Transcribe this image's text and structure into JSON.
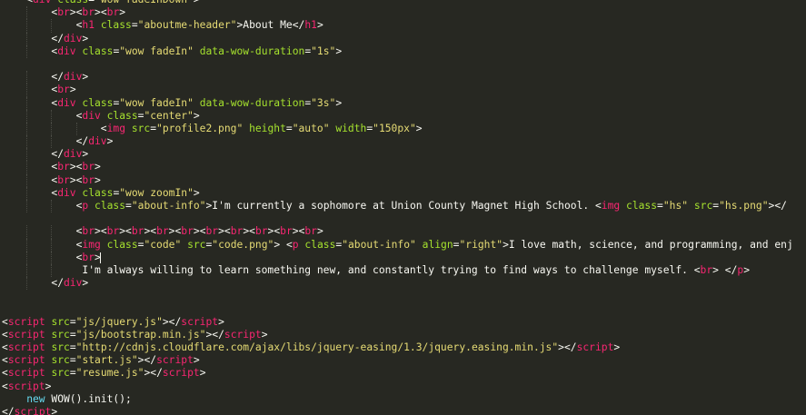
{
  "editor": {
    "theme": {
      "background": "#272822",
      "text": "#f8f8f2",
      "tag": "#f92672",
      "attribute": "#a6e22e",
      "string": "#e6db74",
      "keyword": "#66d9ef"
    },
    "lines": [
      {
        "indent": 1,
        "tokens": [
          [
            "p",
            "<"
          ],
          [
            "tag",
            "div"
          ],
          [
            "text",
            " "
          ],
          [
            "attr",
            "class"
          ],
          [
            "p",
            "="
          ],
          [
            "str",
            "\"wow fadeInDown\""
          ],
          [
            "p",
            ">"
          ]
        ]
      },
      {
        "indent": 2,
        "tokens": [
          [
            "p",
            "<"
          ],
          [
            "tag",
            "br"
          ],
          [
            "p",
            "><"
          ],
          [
            "tag",
            "br"
          ],
          [
            "p",
            "><"
          ],
          [
            "tag",
            "br"
          ],
          [
            "p",
            ">"
          ]
        ]
      },
      {
        "indent": 3,
        "tokens": [
          [
            "p",
            "<"
          ],
          [
            "tag",
            "h1"
          ],
          [
            "text",
            " "
          ],
          [
            "attr",
            "class"
          ],
          [
            "p",
            "="
          ],
          [
            "str",
            "\"aboutme-header\""
          ],
          [
            "p",
            ">"
          ],
          [
            "text",
            "About Me"
          ],
          [
            "p",
            "</"
          ],
          [
            "tag",
            "h1"
          ],
          [
            "p",
            ">"
          ]
        ]
      },
      {
        "indent": 2,
        "tokens": [
          [
            "p",
            "</"
          ],
          [
            "tag",
            "div"
          ],
          [
            "p",
            ">"
          ]
        ]
      },
      {
        "indent": 2,
        "tokens": [
          [
            "p",
            "<"
          ],
          [
            "tag",
            "div"
          ],
          [
            "text",
            " "
          ],
          [
            "attr",
            "class"
          ],
          [
            "p",
            "="
          ],
          [
            "str",
            "\"wow fadeIn\""
          ],
          [
            "text",
            " "
          ],
          [
            "attr",
            "data-wow-duration"
          ],
          [
            "p",
            "="
          ],
          [
            "str",
            "\"1s\""
          ],
          [
            "p",
            ">"
          ]
        ]
      },
      {
        "indent": 0,
        "tokens": []
      },
      {
        "indent": 2,
        "tokens": [
          [
            "p",
            "</"
          ],
          [
            "tag",
            "div"
          ],
          [
            "p",
            ">"
          ]
        ]
      },
      {
        "indent": 2,
        "tokens": [
          [
            "p",
            "<"
          ],
          [
            "tag",
            "br"
          ],
          [
            "p",
            ">"
          ]
        ]
      },
      {
        "indent": 2,
        "tokens": [
          [
            "p",
            "<"
          ],
          [
            "tag",
            "div"
          ],
          [
            "text",
            " "
          ],
          [
            "attr",
            "class"
          ],
          [
            "p",
            "="
          ],
          [
            "str",
            "\"wow fadeIn\""
          ],
          [
            "text",
            " "
          ],
          [
            "attr",
            "data-wow-duration"
          ],
          [
            "p",
            "="
          ],
          [
            "str",
            "\"3s\""
          ],
          [
            "p",
            ">"
          ]
        ]
      },
      {
        "indent": 3,
        "tokens": [
          [
            "p",
            "<"
          ],
          [
            "tag",
            "div"
          ],
          [
            "text",
            " "
          ],
          [
            "attr",
            "class"
          ],
          [
            "p",
            "="
          ],
          [
            "str",
            "\"center\""
          ],
          [
            "p",
            ">"
          ]
        ]
      },
      {
        "indent": 4,
        "tokens": [
          [
            "p",
            "<"
          ],
          [
            "tag",
            "img"
          ],
          [
            "text",
            " "
          ],
          [
            "attr",
            "src"
          ],
          [
            "p",
            "="
          ],
          [
            "str",
            "\"profile2.png\""
          ],
          [
            "text",
            " "
          ],
          [
            "attr",
            "height"
          ],
          [
            "p",
            "="
          ],
          [
            "str",
            "\"auto\""
          ],
          [
            "text",
            " "
          ],
          [
            "attr",
            "width"
          ],
          [
            "p",
            "="
          ],
          [
            "str",
            "\"150px\""
          ],
          [
            "p",
            ">"
          ]
        ]
      },
      {
        "indent": 3,
        "tokens": [
          [
            "p",
            "</"
          ],
          [
            "tag",
            "div"
          ],
          [
            "p",
            ">"
          ]
        ]
      },
      {
        "indent": 2,
        "tokens": [
          [
            "p",
            "</"
          ],
          [
            "tag",
            "div"
          ],
          [
            "p",
            ">"
          ]
        ]
      },
      {
        "indent": 2,
        "tokens": [
          [
            "p",
            "<"
          ],
          [
            "tag",
            "br"
          ],
          [
            "p",
            "><"
          ],
          [
            "tag",
            "br"
          ],
          [
            "p",
            ">"
          ]
        ]
      },
      {
        "indent": 2,
        "tokens": [
          [
            "p",
            "<"
          ],
          [
            "tag",
            "br"
          ],
          [
            "p",
            "><"
          ],
          [
            "tag",
            "br"
          ],
          [
            "p",
            ">"
          ]
        ]
      },
      {
        "indent": 2,
        "tokens": [
          [
            "p",
            "<"
          ],
          [
            "tag",
            "div"
          ],
          [
            "text",
            " "
          ],
          [
            "attr",
            "class"
          ],
          [
            "p",
            "="
          ],
          [
            "str",
            "\"wow zoomIn\""
          ],
          [
            "p",
            ">"
          ]
        ]
      },
      {
        "indent": 3,
        "tokens": [
          [
            "p",
            "<"
          ],
          [
            "tag",
            "p"
          ],
          [
            "text",
            " "
          ],
          [
            "attr",
            "class"
          ],
          [
            "p",
            "="
          ],
          [
            "str",
            "\"about-info\""
          ],
          [
            "p",
            ">"
          ],
          [
            "text",
            "I'm currently a sophomore at Union County Magnet High School. "
          ],
          [
            "p",
            "<"
          ],
          [
            "tag",
            "img"
          ],
          [
            "text",
            " "
          ],
          [
            "attr",
            "class"
          ],
          [
            "p",
            "="
          ],
          [
            "str",
            "\"hs\""
          ],
          [
            "text",
            " "
          ],
          [
            "attr",
            "src"
          ],
          [
            "p",
            "="
          ],
          [
            "str",
            "\"hs.png\""
          ],
          [
            "p",
            "></"
          ]
        ]
      },
      {
        "indent": 0,
        "tokens": []
      },
      {
        "indent": 3,
        "tokens": [
          [
            "p",
            "<"
          ],
          [
            "tag",
            "br"
          ],
          [
            "p",
            "><"
          ],
          [
            "tag",
            "br"
          ],
          [
            "p",
            "><"
          ],
          [
            "tag",
            "br"
          ],
          [
            "p",
            "><"
          ],
          [
            "tag",
            "br"
          ],
          [
            "p",
            "><"
          ],
          [
            "tag",
            "br"
          ],
          [
            "p",
            "><"
          ],
          [
            "tag",
            "br"
          ],
          [
            "p",
            "><"
          ],
          [
            "tag",
            "br"
          ],
          [
            "p",
            "><"
          ],
          [
            "tag",
            "br"
          ],
          [
            "p",
            "><"
          ],
          [
            "tag",
            "br"
          ],
          [
            "p",
            "><"
          ],
          [
            "tag",
            "br"
          ],
          [
            "p",
            ">"
          ]
        ]
      },
      {
        "indent": 3,
        "tokens": [
          [
            "p",
            "<"
          ],
          [
            "tag",
            "img"
          ],
          [
            "text",
            " "
          ],
          [
            "attr",
            "class"
          ],
          [
            "p",
            "="
          ],
          [
            "str",
            "\"code\""
          ],
          [
            "text",
            " "
          ],
          [
            "attr",
            "src"
          ],
          [
            "p",
            "="
          ],
          [
            "str",
            "\"code.png\""
          ],
          [
            "p",
            ">"
          ],
          [
            "text",
            " "
          ],
          [
            "p",
            "<"
          ],
          [
            "tag",
            "p"
          ],
          [
            "text",
            " "
          ],
          [
            "attr",
            "class"
          ],
          [
            "p",
            "="
          ],
          [
            "str",
            "\"about-info\""
          ],
          [
            "text",
            " "
          ],
          [
            "attr",
            "align"
          ],
          [
            "p",
            "="
          ],
          [
            "str",
            "\"right\""
          ],
          [
            "p",
            ">"
          ],
          [
            "text",
            "I love math, science, and programming, and enj"
          ]
        ]
      },
      {
        "indent": 3,
        "caret": true,
        "tokens": [
          [
            "p",
            "<"
          ],
          [
            "tag",
            "br"
          ],
          [
            "p",
            ">"
          ]
        ]
      },
      {
        "indent": 3,
        "tokens": [
          [
            "text",
            " I'm always willing to learn something new, and constantly trying to find ways to challenge myself. "
          ],
          [
            "p",
            "<"
          ],
          [
            "tag",
            "br"
          ],
          [
            "p",
            ">"
          ],
          [
            "text",
            " "
          ],
          [
            "p",
            "</"
          ],
          [
            "tag",
            "p"
          ],
          [
            "p",
            ">"
          ]
        ]
      },
      {
        "indent": 2,
        "tokens": [
          [
            "p",
            "</"
          ],
          [
            "tag",
            "div"
          ],
          [
            "p",
            ">"
          ]
        ]
      },
      {
        "indent": 0,
        "tokens": []
      },
      {
        "indent": 0,
        "tokens": []
      },
      {
        "indent": 0,
        "tokens": [
          [
            "p",
            "<"
          ],
          [
            "tag",
            "script"
          ],
          [
            "text",
            " "
          ],
          [
            "attr",
            "src"
          ],
          [
            "p",
            "="
          ],
          [
            "str",
            "\"js/jquery.js\""
          ],
          [
            "p",
            "></"
          ],
          [
            "tag",
            "script"
          ],
          [
            "p",
            ">"
          ]
        ]
      },
      {
        "indent": 0,
        "tokens": [
          [
            "p",
            "<"
          ],
          [
            "tag",
            "script"
          ],
          [
            "text",
            " "
          ],
          [
            "attr",
            "src"
          ],
          [
            "p",
            "="
          ],
          [
            "str",
            "\"js/bootstrap.min.js\""
          ],
          [
            "p",
            "></"
          ],
          [
            "tag",
            "script"
          ],
          [
            "p",
            ">"
          ]
        ]
      },
      {
        "indent": 0,
        "tokens": [
          [
            "p",
            "<"
          ],
          [
            "tag",
            "script"
          ],
          [
            "text",
            " "
          ],
          [
            "attr",
            "src"
          ],
          [
            "p",
            "="
          ],
          [
            "str",
            "\"http://cdnjs.cloudflare.com/ajax/libs/jquery-easing/1.3/jquery.easing.min.js\""
          ],
          [
            "p",
            "></"
          ],
          [
            "tag",
            "script"
          ],
          [
            "p",
            ">"
          ]
        ]
      },
      {
        "indent": 0,
        "tokens": [
          [
            "p",
            "<"
          ],
          [
            "tag",
            "script"
          ],
          [
            "text",
            " "
          ],
          [
            "attr",
            "src"
          ],
          [
            "p",
            "="
          ],
          [
            "str",
            "\"start.js\""
          ],
          [
            "p",
            "></"
          ],
          [
            "tag",
            "script"
          ],
          [
            "p",
            ">"
          ]
        ]
      },
      {
        "indent": 0,
        "tokens": [
          [
            "p",
            "<"
          ],
          [
            "tag",
            "script"
          ],
          [
            "text",
            " "
          ],
          [
            "attr",
            "src"
          ],
          [
            "p",
            "="
          ],
          [
            "str",
            "\"resume.js\""
          ],
          [
            "p",
            "></"
          ],
          [
            "tag",
            "script"
          ],
          [
            "p",
            ">"
          ]
        ]
      },
      {
        "indent": 0,
        "tokens": [
          [
            "p",
            "<"
          ],
          [
            "tag",
            "script"
          ],
          [
            "p",
            ">"
          ]
        ]
      },
      {
        "indent": 1,
        "tokens": [
          [
            "kw",
            "new"
          ],
          [
            "text",
            " WOW().init();"
          ]
        ]
      },
      {
        "indent": 0,
        "tokens": [
          [
            "p",
            "</"
          ],
          [
            "tag",
            "script"
          ],
          [
            "p",
            ">"
          ]
        ]
      }
    ]
  }
}
